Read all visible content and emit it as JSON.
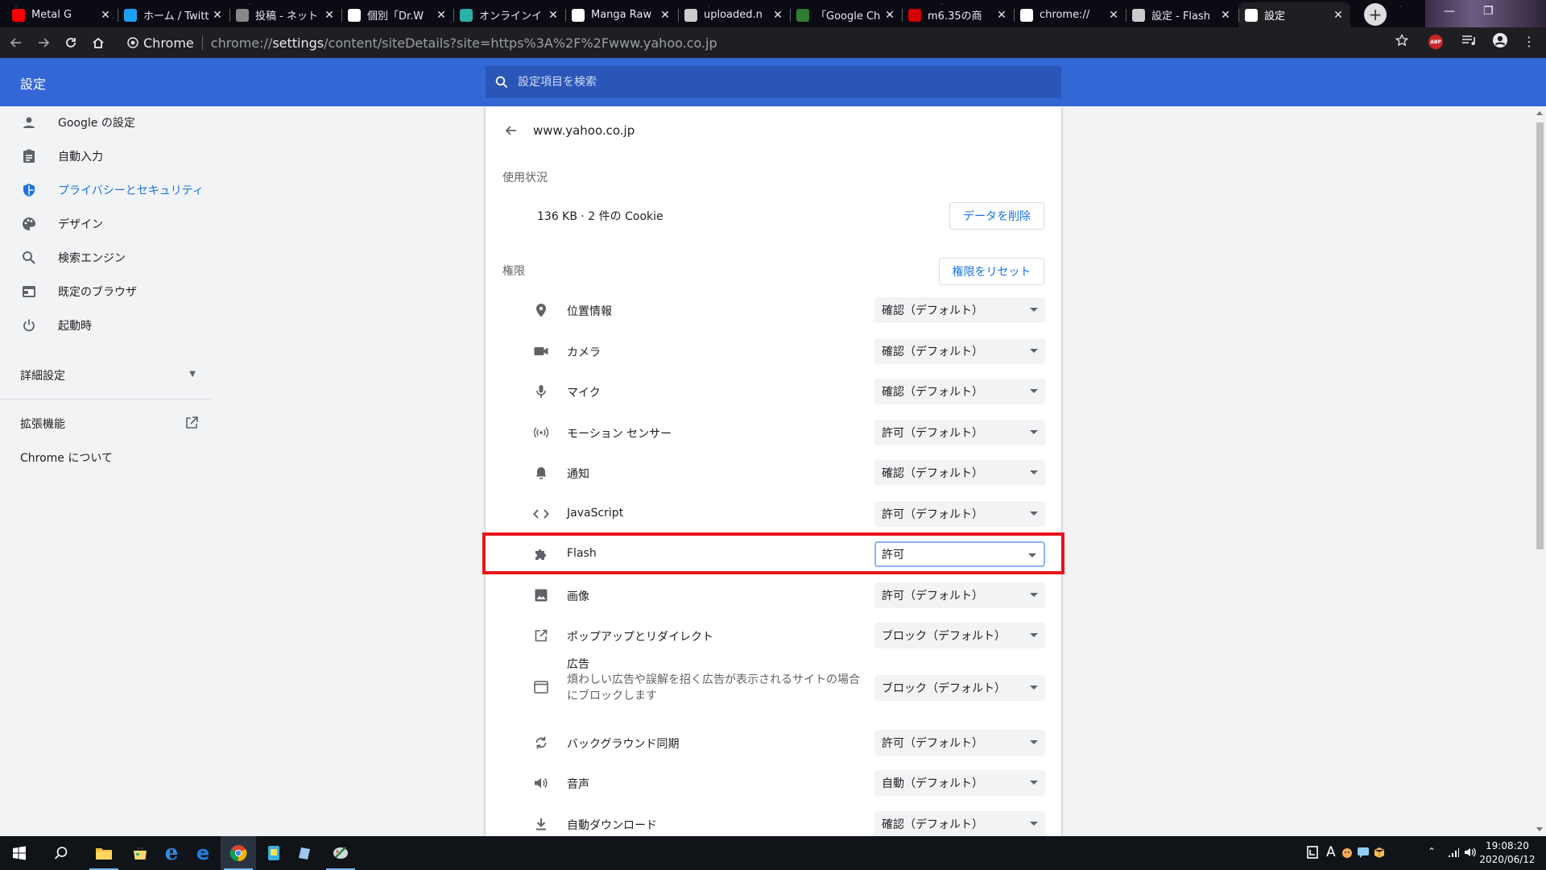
{
  "browser": {
    "tabs": [
      {
        "title": "Metal G",
        "icon": "youtube-icon",
        "color": "#ff0000"
      },
      {
        "title": "ホーム / Twitt",
        "icon": "twitter-icon",
        "color": "#1da1f2"
      },
      {
        "title": "投稿 - ネット",
        "icon": "shield-icon",
        "color": "#888888"
      },
      {
        "title": "個別「Dr.W",
        "icon": "page-icon",
        "color": "#ffffff"
      },
      {
        "title": "オンラインイ",
        "icon": "online-icon",
        "color": "#2bb0a6"
      },
      {
        "title": "Manga Raw",
        "icon": "hd-icon",
        "color": "#ffffff"
      },
      {
        "title": "uploaded.n",
        "icon": "globe-icon",
        "color": "#cccccc"
      },
      {
        "title": "「Google Ch",
        "icon": "gc-icon",
        "color": "#2e7d32"
      },
      {
        "title": "m6.35の商",
        "icon": "yahoo-icon",
        "color": "#d50000"
      },
      {
        "title": "chrome://",
        "icon": "a-icon",
        "color": "#ffffff"
      },
      {
        "title": "設定 - Flash",
        "icon": "gear-icon",
        "color": "#cccccc"
      },
      {
        "title": "設定",
        "icon": "gear-icon",
        "color": "#ffffff",
        "active": true
      }
    ],
    "omnibox": {
      "chip": "Chrome",
      "url_prefix": "chrome://",
      "url_host": "settings",
      "url_rest": "/content/siteDetails?site=https%3A%2F%2Fwww.yahoo.co.jp"
    },
    "ext_badge": "ABP"
  },
  "header": {
    "title": "設定",
    "search_placeholder": "設定項目を検索"
  },
  "sidebar": {
    "items": [
      {
        "label": "Google の設定",
        "icon": "person-icon"
      },
      {
        "label": "自動入力",
        "icon": "clipboard-icon"
      },
      {
        "label": "プライバシーとセキュリティ",
        "icon": "shield-icon",
        "active": true
      },
      {
        "label": "デザイン",
        "icon": "palette-icon"
      },
      {
        "label": "検索エンジン",
        "icon": "search-icon"
      },
      {
        "label": "既定のブラウザ",
        "icon": "browser-icon"
      },
      {
        "label": "起動時",
        "icon": "power-icon"
      }
    ],
    "advanced": "詳細設定",
    "extensions": "拡張機能",
    "about": "Chrome について"
  },
  "site": {
    "name": "www.yahoo.co.jp",
    "usage_heading": "使用状況",
    "usage_text": "136 KB · 2 件の Cookie",
    "clear_button": "データを削除",
    "permissions_heading": "権限",
    "reset_button": "権限をリセット",
    "permissions": [
      {
        "label": "位置情報",
        "icon": "location-icon",
        "value": "確認（デフォルト）"
      },
      {
        "label": "カメラ",
        "icon": "camera-icon",
        "value": "確認（デフォルト）"
      },
      {
        "label": "マイク",
        "icon": "mic-icon",
        "value": "確認（デフォルト）"
      },
      {
        "label": "モーション センサー",
        "icon": "sensor-icon",
        "value": "許可（デフォルト）"
      },
      {
        "label": "通知",
        "icon": "bell-icon",
        "value": "確認（デフォルト）"
      },
      {
        "label": "JavaScript",
        "icon": "code-icon",
        "value": "許可（デフォルト）"
      },
      {
        "label": "Flash",
        "icon": "puzzle-icon",
        "value": "許可",
        "focused": true
      },
      {
        "label": "画像",
        "icon": "image-icon",
        "value": "許可（デフォルト）"
      },
      {
        "label": "ポップアップとリダイレクト",
        "icon": "popup-icon",
        "value": "ブロック（デフォルト）"
      },
      {
        "label": "広告",
        "icon": "ad-icon",
        "value": "ブロック（デフォルト）",
        "sub": "煩わしい広告や誤解を招く広告が表示されるサイトの場合にブロックします"
      },
      {
        "label": "バックグラウンド同期",
        "icon": "sync-icon",
        "value": "許可（デフォルト）"
      },
      {
        "label": "音声",
        "icon": "speaker-icon",
        "value": "自動（デフォルト）"
      },
      {
        "label": "自動ダウンロード",
        "icon": "download-icon",
        "value": "確認（デフォルト）"
      }
    ]
  },
  "taskbar": {
    "time": "19:08:20",
    "date": "2020/06/12",
    "ime": "A"
  },
  "colors": {
    "accent": "#3367d6",
    "link": "#1a73e8",
    "highlight": "#e8141c"
  }
}
